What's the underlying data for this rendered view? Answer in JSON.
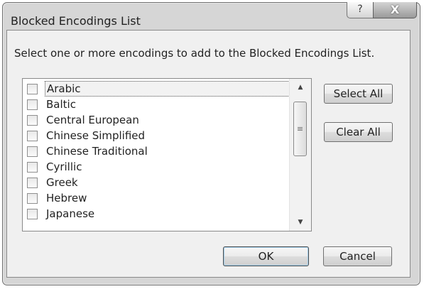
{
  "window": {
    "title": "Blocked Encodings List",
    "help_glyph": "?",
    "close_glyph": "X"
  },
  "instruction": "Select one or more encodings to add to the Blocked Encodings List.",
  "encodings": [
    {
      "label": "Arabic",
      "checked": false
    },
    {
      "label": "Baltic",
      "checked": false
    },
    {
      "label": "Central European",
      "checked": false
    },
    {
      "label": "Chinese Simplified",
      "checked": false
    },
    {
      "label": "Chinese Traditional",
      "checked": false
    },
    {
      "label": "Cyrillic",
      "checked": false
    },
    {
      "label": "Greek",
      "checked": false
    },
    {
      "label": "Hebrew",
      "checked": false
    },
    {
      "label": "Japanese",
      "checked": false
    }
  ],
  "scrollbar": {
    "up_glyph": "▲",
    "down_glyph": "▼",
    "grip_glyph": "≡"
  },
  "buttons": {
    "select_all": "Select All",
    "clear_all": "Clear All",
    "ok": "OK",
    "cancel": "Cancel"
  }
}
